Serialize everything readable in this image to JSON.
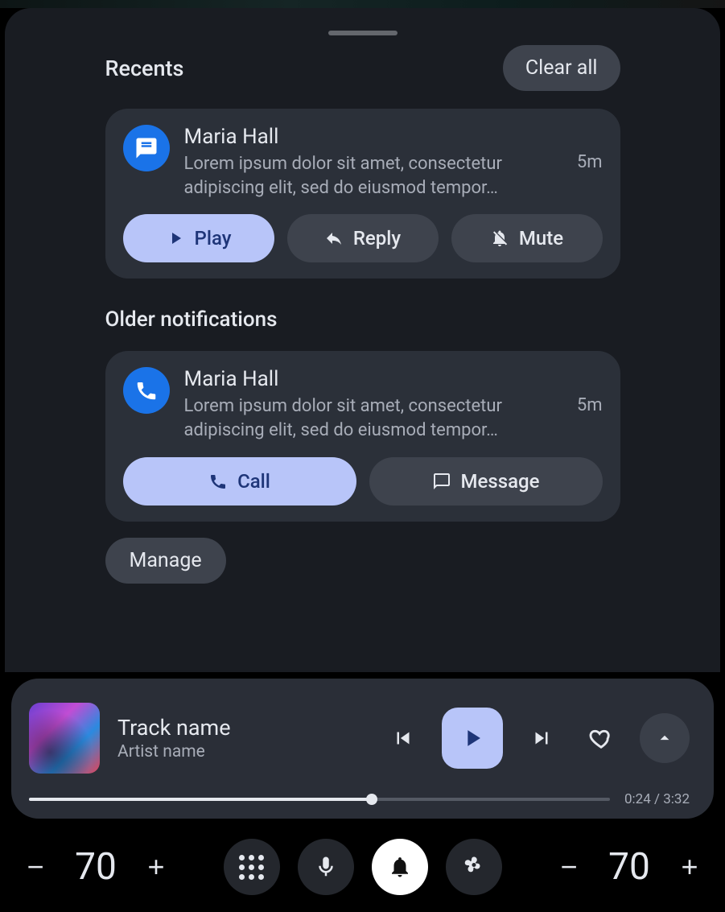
{
  "header": {
    "title": "Recents",
    "clear": "Clear all"
  },
  "recents": [
    {
      "sender": "Maria Hall",
      "body": "Lorem ipsum dolor sit amet, consectetur adipiscing elit, sed do eiusmod tempor…",
      "time": "5m",
      "actions": {
        "play": "Play",
        "reply": "Reply",
        "mute": "Mute"
      }
    }
  ],
  "older_title": "Older notifications",
  "older": [
    {
      "sender": "Maria Hall",
      "body": "Lorem ipsum dolor sit amet, consectetur adipiscing elit, sed do eiusmod tempor…",
      "time": "5m",
      "actions": {
        "call": "Call",
        "message": "Message"
      }
    }
  ],
  "manage": "Manage",
  "media": {
    "track": "Track name",
    "artist": "Artist name",
    "elapsed": "0:24",
    "total": "3:32"
  },
  "sysbar": {
    "left_temp": "70",
    "right_temp": "70"
  }
}
